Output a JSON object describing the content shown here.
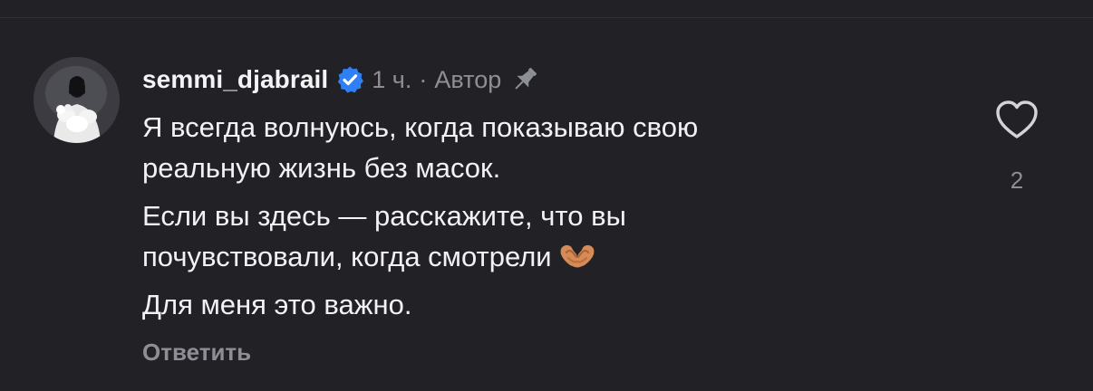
{
  "comment": {
    "username": "semmi_djabrail",
    "time": "1 ч.",
    "separator": "·",
    "author_badge": "Автор",
    "paragraphs": [
      "Я всегда волнуюсь, когда показываю свою\nреальную жизнь без масок.",
      "Если вы здесь — расскажите, что вы\nпочувствовали, когда смотрели",
      "Для меня это важно."
    ],
    "reply_label": "Ответить",
    "like_count": "2",
    "icons": {
      "verified": "verified-badge-icon",
      "pin": "pin-icon",
      "like": "heart-icon",
      "emoji": "heart-hands-emoji"
    },
    "colors": {
      "background": "#212126",
      "verified": "#2f7ff5",
      "secondary_text": "#8e8e95"
    }
  }
}
